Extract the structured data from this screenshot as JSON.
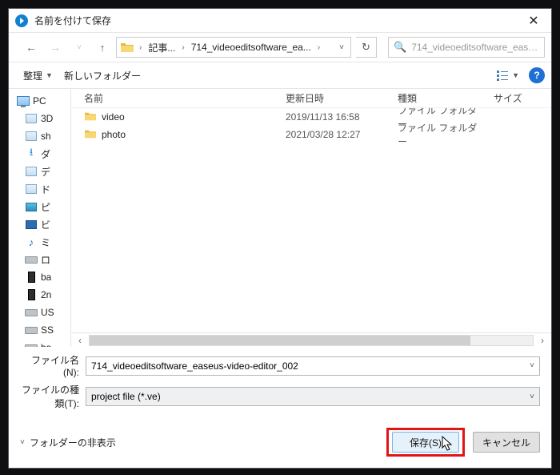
{
  "window": {
    "title": "名前を付けて保存"
  },
  "nav": {
    "crumb1": "記事...",
    "crumb2": "714_videoeditsoftware_ea...",
    "crumb3": "",
    "search_placeholder": "714_videoeditsoftware_ease..."
  },
  "toolbar": {
    "organize": "整理",
    "new_folder": "新しいフォルダー"
  },
  "columns": {
    "name": "名前",
    "date": "更新日時",
    "type": "種類",
    "size": "サイズ"
  },
  "tree": {
    "items": [
      {
        "icon": "monitor",
        "label": "PC"
      },
      {
        "icon": "box",
        "label": "3D"
      },
      {
        "icon": "box",
        "label": "sh"
      },
      {
        "icon": "download",
        "label": "ダ"
      },
      {
        "icon": "box",
        "label": "デ"
      },
      {
        "icon": "box",
        "label": "ド"
      },
      {
        "icon": "photo",
        "label": "ピ"
      },
      {
        "icon": "video",
        "label": "ビ"
      },
      {
        "icon": "music",
        "label": "ミ"
      },
      {
        "icon": "drive",
        "label": "ロ"
      },
      {
        "icon": "tower",
        "label": "ba"
      },
      {
        "icon": "tower",
        "label": "2n"
      },
      {
        "icon": "drive",
        "label": "US"
      },
      {
        "icon": "drive",
        "label": "SS"
      },
      {
        "icon": "drive",
        "label": "ba"
      }
    ]
  },
  "rows": [
    {
      "name": "video",
      "date": "2019/11/13 16:58",
      "type": "ファイル フォルダー"
    },
    {
      "name": "photo",
      "date": "2021/03/28 12:27",
      "type": "ファイル フォルダー"
    }
  ],
  "fields": {
    "filename_label": "ファイル名(N):",
    "filename_value": "714_videoeditsoftware_easeus-video-editor_002",
    "filetype_label": "ファイルの種類(T):",
    "filetype_value": "project file (*.ve)"
  },
  "footer": {
    "hide_folders": "フォルダーの非表示",
    "save": "保存(S)",
    "cancel": "キャンセル"
  }
}
